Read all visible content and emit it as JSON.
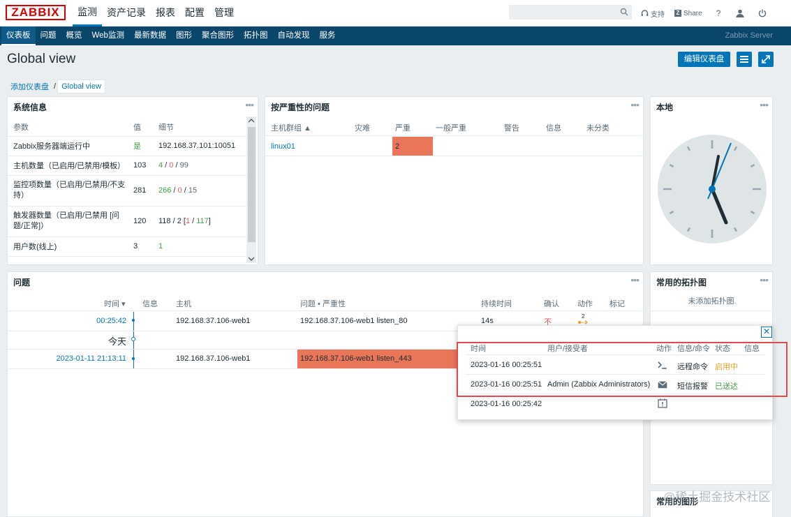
{
  "logo": "ZABBIX",
  "main_menu": [
    "监测",
    "资产记录",
    "报表",
    "配置",
    "管理"
  ],
  "search_placeholder": "",
  "top_links": {
    "support": "支持",
    "share": "Share",
    "help": "?"
  },
  "sub_menu": [
    "仪表板",
    "问题",
    "概览",
    "Web监测",
    "最新数据",
    "图形",
    "聚合图形",
    "拓扑图",
    "自动发现",
    "服务"
  ],
  "server_name": "Zabbix Server",
  "page_title": "Global view",
  "edit_button": "编辑仪表盘",
  "breadcrumb": [
    "添加仪表盘",
    "/",
    "Global view"
  ],
  "sysinfo": {
    "title": "系统信息",
    "headers": [
      "参数",
      "值",
      "细节"
    ],
    "rows": [
      {
        "param": "Zabbix服务器端运行中",
        "value": "是",
        "detail": "192.168.37.101:10051"
      },
      {
        "param": "主机数量（已启用/已禁用/模板）",
        "value": "103",
        "d1": "4",
        "s1": " / ",
        "d2": "0",
        "s2": " / ",
        "d3": "99"
      },
      {
        "param": "监控项数量（已启用/已禁用/不支持）",
        "value": "281",
        "d1": "266",
        "s1": " / ",
        "d2": "0",
        "s2": " / ",
        "d3": "15"
      },
      {
        "param": "触发器数量（已启用/已禁用 [问题/正常]）",
        "value": "120",
        "d0": "118 / 2 [",
        "d1": "1",
        "s1": " / ",
        "d2": "117",
        "s2": "]"
      },
      {
        "param": "用户数(线上)",
        "value": "3",
        "d1": "1"
      }
    ]
  },
  "severity": {
    "title": "按严重性的问题",
    "headers": [
      "主机群组 ▲",
      "灾难",
      "严重",
      "一般严重",
      "警告",
      "信息",
      "未分类"
    ],
    "row": {
      "group": "linux01",
      "high": "2"
    }
  },
  "local": {
    "title": "本地"
  },
  "problems": {
    "title": "问题",
    "headers": [
      "时间 ▾",
      "信息",
      "主机",
      "问题 • 严重性",
      "持续时间",
      "确认",
      "动作",
      "标记"
    ],
    "rows": [
      {
        "time": "00:25:42",
        "host": "192.168.37.106-web1",
        "problem": "192.168.37.106-web1 listen_80",
        "duration": "14s",
        "ack": "不",
        "action": "2"
      },
      {
        "time": "2023-01-11 21:13:11",
        "host": "192.168.37.106-web1",
        "problem": "192.168.37.106-web1 listen_443"
      }
    ],
    "today": "今天"
  },
  "maps": {
    "title": "常用的拓扑图",
    "empty": "未添加拓扑图."
  },
  "graphs": {
    "title": "常用的图形"
  },
  "popup": {
    "headers": [
      "时间",
      "用户/接受者",
      "动作",
      "信息/命令",
      "状态",
      "信息"
    ],
    "rows": [
      {
        "time": "2023-01-16 00:25:51",
        "user": "",
        "cmd": "远程命令",
        "status": "启用中"
      },
      {
        "time": "2023-01-16 00:25:51",
        "user": "Admin (Zabbix Administrators)",
        "cmd": "短信报警",
        "status": "已送达"
      },
      {
        "time": "2023-01-16 00:25:42",
        "user": "",
        "cmd": "",
        "status": ""
      }
    ]
  },
  "watermark": "@稀土掘金技术社区",
  "colors": {
    "accent": "#0275b8",
    "nav": "#0a466a",
    "high": "#e97659",
    "green": "#429e47",
    "red": "#e45959",
    "orange": "#f0a020"
  }
}
